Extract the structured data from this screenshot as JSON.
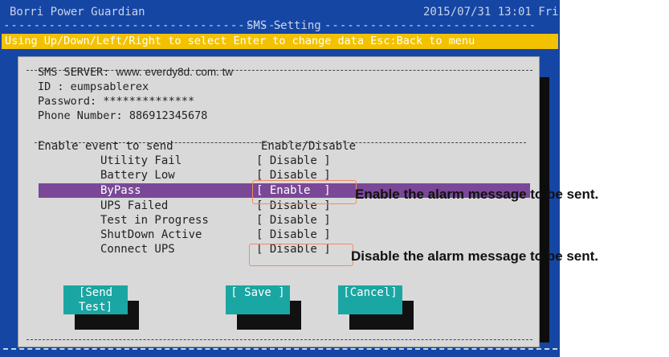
{
  "window": {
    "app_title": "Borri Power Guardian",
    "section_title": "SMS Setting",
    "datetime": "2015/07/31 13:01 Fri"
  },
  "hint": "Using Up/Down/Left/Right to select Enter to change data  Esc:Back to menu",
  "sms": {
    "server_label": "SMS SERVER:",
    "server_value": "www. everdy8d. com. tw",
    "id_label": "ID :",
    "id_value": "eumpsablerex",
    "password_label": "Password:",
    "password_value": "**************",
    "phone_label": "Phone Number:",
    "phone_value": "886912345678"
  },
  "events": {
    "header_left": "Enable event to send",
    "header_right": "Enable/Disable",
    "items": [
      {
        "name": "Utility Fail",
        "state": "[ Disable ]"
      },
      {
        "name": "Battery Low",
        "state": "[ Disable ]"
      },
      {
        "name": "ByPass",
        "state": "[ Enable  ]"
      },
      {
        "name": "UPS Failed",
        "state": "[ Disable ]"
      },
      {
        "name": "Test in Progress",
        "state": "[ Disable ]"
      },
      {
        "name": "ShutDown Active",
        "state": "[ Disable ]"
      },
      {
        "name": "Connect UPS",
        "state": "[ Disable ]"
      }
    ]
  },
  "buttons": {
    "send_test": "[Send Test]",
    "save": "[ Save ]",
    "cancel": "[Cancel]"
  },
  "callouts": {
    "enable": "Enable the alarm message to be sent.",
    "disable": "Disable the alarm message to be sent."
  },
  "colors": {
    "screen_bg": "#1546a4",
    "hint_bg": "#f2c200",
    "panel_bg": "#d9d9d9",
    "highlight": "#7a4896",
    "button": "#1aa6a3",
    "marker": "#f08a6a"
  }
}
